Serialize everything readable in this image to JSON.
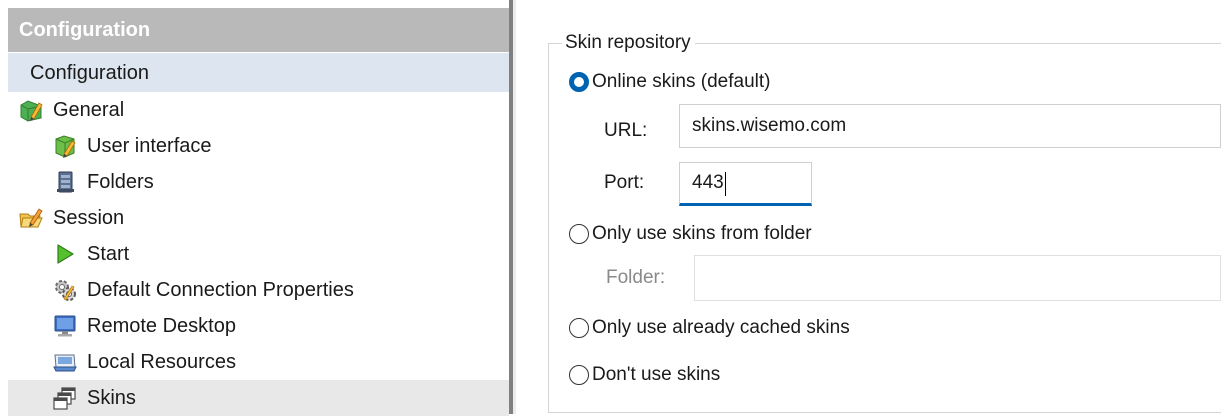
{
  "left_pane": {
    "header_title": "Configuration",
    "subheader_title": "Configuration",
    "tree": [
      {
        "label": "General",
        "icon": "general-icon"
      },
      {
        "label": "User interface",
        "icon": "user-interface-icon"
      },
      {
        "label": "Folders",
        "icon": "folders-icon"
      },
      {
        "label": "Session",
        "icon": "session-icon"
      },
      {
        "label": "Start",
        "icon": "start-icon"
      },
      {
        "label": "Default Connection Properties",
        "icon": "gears-icon"
      },
      {
        "label": "Remote Desktop",
        "icon": "monitor-icon"
      },
      {
        "label": "Local Resources",
        "icon": "local-resources-icon"
      },
      {
        "label": "Skins",
        "icon": "skins-icon",
        "selected": true
      }
    ]
  },
  "skin_repository": {
    "legend": "Skin repository",
    "online": {
      "label": "Online skins (default)",
      "checked": true
    },
    "url": {
      "label": "URL:",
      "value": "skins.wisemo.com"
    },
    "port": {
      "label": "Port:",
      "value": "443"
    },
    "folder_option": {
      "label": "Only use skins from folder",
      "checked": false
    },
    "folder": {
      "label": "Folder:",
      "value": ""
    },
    "cached_option": {
      "label": "Only use already cached skins",
      "checked": false
    },
    "none_option": {
      "label": "Don't use skins",
      "checked": false
    }
  },
  "colors": {
    "accent": "#0063b1",
    "header_bg": "#b9b9b9",
    "subheader_bg": "#dde6f0",
    "selected_bg": "#e8e8e8"
  }
}
